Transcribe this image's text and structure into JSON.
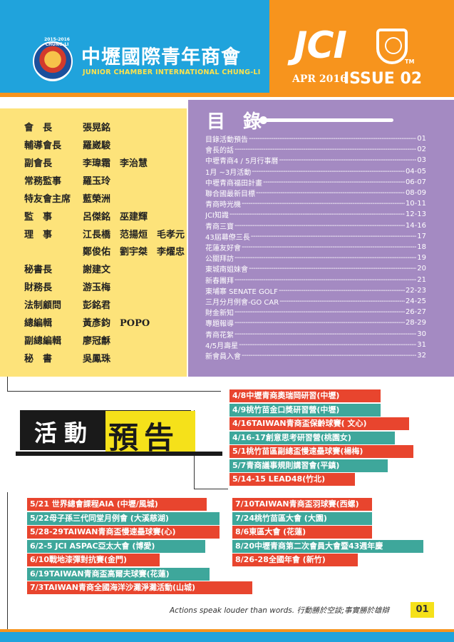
{
  "header": {
    "org_cn": "中壢國際青年商會",
    "org_en": "JUNIOR CHAMBER INTERNATIONAL CHUNG-LI",
    "logo_text": "2015-2016 CHUNG-LI",
    "brand": "JCI",
    "tm": "TM",
    "issue_date": "APR 2016",
    "issue_no": "ISSUE 02"
  },
  "colors": {
    "blue": "#20a3dc",
    "orange": "#f7941d",
    "yellow": "#fde37a",
    "purple": "#a48ac2",
    "red": "#e8452e",
    "teal": "#3ea79b"
  },
  "officers": [
    {
      "title": "會　長",
      "names": "張晃銘"
    },
    {
      "title": "輔導會長",
      "names": "羅崴駿"
    },
    {
      "title": "副會長",
      "names": "李瑋霜　李治慧"
    },
    {
      "title": "常務監事",
      "names": "羅玉玲"
    },
    {
      "title": "特友會主席",
      "names": "藍榮洲"
    },
    {
      "title": "監　事",
      "names": "呂傑銘　巫建輝"
    },
    {
      "title": "理　事",
      "names": "江長橋　范揚烜　毛孝元"
    },
    {
      "title": "",
      "names": "鄭俊佑　劉宇桀　李燿忠"
    },
    {
      "title": "秘書長",
      "names": "謝建文"
    },
    {
      "title": "財務長",
      "names": "游玉梅"
    },
    {
      "title": "法制顧問",
      "names": "彭銘君"
    },
    {
      "title": "總編輯",
      "names": "黃彥鈞　POPO"
    },
    {
      "title": "副總編輯",
      "names": "廖冠龢"
    },
    {
      "title": "秘　書",
      "names": "吳鳳珠"
    }
  ],
  "toc": {
    "title": "目 錄",
    "items": [
      {
        "label": "目錄活動預告",
        "page": "01"
      },
      {
        "label": "會長的話",
        "page": "02"
      },
      {
        "label": "中壢青商4 / 5月行事曆",
        "page": "03"
      },
      {
        "label": "1月 ~3月活動",
        "page": "04-05"
      },
      {
        "label": "中壢青商福田計畫",
        "page": "06-07"
      },
      {
        "label": "聯合國最新目標",
        "page": "08-09"
      },
      {
        "label": "青商時光機",
        "page": "10-11"
      },
      {
        "label": "JCI知識",
        "page": "12-13"
      },
      {
        "label": "青商三寶",
        "page": "14-16"
      },
      {
        "label": "43屆幕僚三長",
        "page": "17"
      },
      {
        "label": "花蓮友好會",
        "page": "18"
      },
      {
        "label": "公關拜訪",
        "page": "19"
      },
      {
        "label": "東城南姐妹會",
        "page": "20"
      },
      {
        "label": "新春團拜",
        "page": "21"
      },
      {
        "label": "東埔寨 SENATE GOLF",
        "page": "22-23"
      },
      {
        "label": "三月分月例會-GO CAR",
        "page": "24-25"
      },
      {
        "label": "財金新知",
        "page": "26-27"
      },
      {
        "label": "專題報導",
        "page": "28-29"
      },
      {
        "label": "青商花絮",
        "page": "30"
      },
      {
        "label": "4/5月壽星",
        "page": "31"
      },
      {
        "label": "新會員入會",
        "page": "32"
      }
    ]
  },
  "events": {
    "banner_a": "活動",
    "banner_b": "預告",
    "top": [
      {
        "text": "4/8中壢青商奧瑞岡研習(中壢)",
        "color": "red"
      },
      {
        "text": "4/9桃竹苗金口獎研習營(中壢)",
        "color": "teal"
      },
      {
        "text": "4/16TAIWAN青商盃保齡球賽( 文心)",
        "color": "red"
      },
      {
        "text": "4/16-17創意思考研習營(桃園女)",
        "color": "teal"
      },
      {
        "text": "5/1桃竹苗區副總盃慢速壘球賽(楊梅)",
        "color": "red"
      },
      {
        "text": "5/7青商議事規則講習會(平鎮)",
        "color": "teal"
      },
      {
        "text": "5/14-15 LEAD48(竹北)",
        "color": "red"
      }
    ],
    "left": [
      {
        "text": "5/21 世界總會課程AIA (中壢/風城)",
        "color": "red"
      },
      {
        "text": "5/22母子孫三代同堂月例會 (大溪慈湖)",
        "color": "teal"
      },
      {
        "text": "5/28-29TAIWAN青商盃慢速壘球賽(心)",
        "color": "red"
      },
      {
        "text": "6/2-5 JCI ASPAC亞太大會 (博愛)",
        "color": "teal"
      },
      {
        "text": "6/10戰地漆彈對抗賽(金門)",
        "color": "red"
      },
      {
        "text": "6/19TAIWAN青商盃高爾夫球賽(花蓮)",
        "color": "teal"
      },
      {
        "text": "7/3TAIWAN青商全國海洋沙灘淨灘活動(山城)",
        "color": "red"
      }
    ],
    "right": [
      {
        "text": "7/10TAIWAN青商盃羽球賽(西螺)",
        "color": "red"
      },
      {
        "text": "7/24桃竹苗區大會 (大園)",
        "color": "teal"
      },
      {
        "text": "8/6東區大會 (花蓮)",
        "color": "red"
      },
      {
        "text": "8/20中壢青商第二次會員大會暨43週年慶",
        "color": "teal"
      },
      {
        "text": "8/26-28全國年會 (新竹)",
        "color": "red"
      }
    ]
  },
  "footer": {
    "motto": "Actions speak louder than words. 行動勝於空談;事實勝於雄辯",
    "page_no": "01"
  }
}
